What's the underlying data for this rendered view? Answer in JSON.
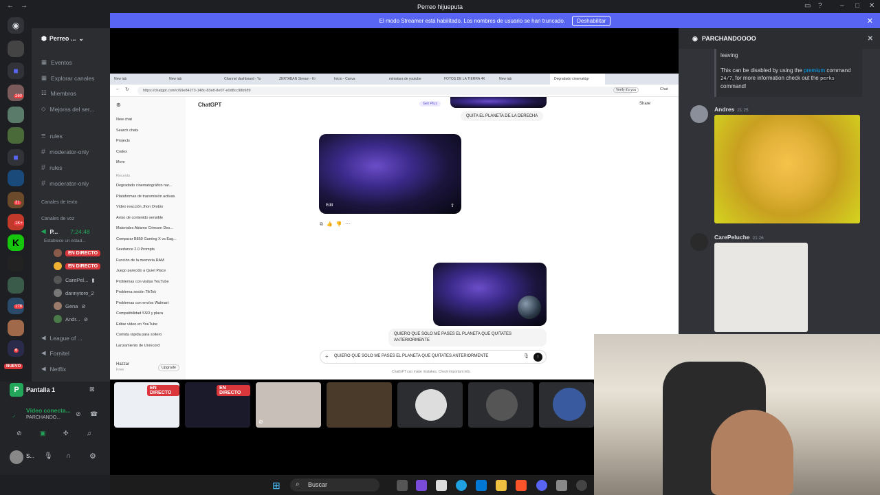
{
  "window": {
    "title": "Perreo hijueputa"
  },
  "banner": {
    "text": "El modo Streamer está habilitado. Los nombres de usuario se han truncado.",
    "button": "Deshabilitar"
  },
  "rail": {
    "badges": [
      "260",
      "31",
      "1K+",
      "178",
      "6"
    ],
    "new_label": "NUEVO"
  },
  "server": {
    "name": "Perreo ..."
  },
  "channels": {
    "items": [
      "Eventos",
      "Explorar canales",
      "Miembros",
      "Mejoras del ser..."
    ],
    "text": [
      "rules",
      "moderator-only",
      "rules",
      "moderator-only"
    ],
    "cat_text": "Canales de texto",
    "cat_voice": "Canales de voz",
    "voice_channel": "P...",
    "voice_time": "7:24:48",
    "voice_status": "Establece un estad...",
    "live": "EN DIRECTO",
    "users": [
      "CarePel...",
      "dannytoro_2",
      "Gena",
      "Andr..."
    ],
    "other_voice": [
      "League of ...",
      "Fornitel",
      "Netflix"
    ]
  },
  "stream_card": {
    "label": "Pantalla 1",
    "status": "Vídeo conecta...",
    "sub": "PARCHANDO...",
    "user": "S..."
  },
  "browser": {
    "tabs": [
      "New tab",
      "New tab",
      "Channel dashboard - Yo",
      "ZERTABAN Stream - Ki",
      "Inicio - Canva",
      "miniatura de youtube",
      "FOTOS DE LA TIERRA 4K",
      "New tab",
      "Degradado cinematógr"
    ],
    "url": "https://chatgpt.com/c/69e84273-148c-83e8-8e07-e0d8cc98b989",
    "verify": "Verify it's you",
    "chat_btn": "Chat"
  },
  "gpt": {
    "brand": "ChatGPT",
    "get_plus": "Get Plus",
    "share": "Share",
    "nav": [
      "New chat",
      "Search chats",
      "Projects",
      "Codex",
      "More"
    ],
    "recents_label": "Recents",
    "recents": [
      "Degradado cinematográfico nar...",
      "Plataformas de transmisión activas",
      "Vídeo reacción Jhon Orobio",
      "Aviso de contenido sensible",
      "Materiales Abismo Crimson Des...",
      "Comparar B850 Gaming X vs Eag...",
      "Seedance 2.0 Prompts",
      "Función de la memoria RAM",
      "Juego parecido a Quiet Place",
      "Problemas con visitas YouTube",
      "Problema sesión TikTok",
      "Problemas con envíos Walmart",
      "Compatibilidad SSD y placa",
      "Editar vídeo en YouTube",
      "Comida rápida para soltero",
      "Lanzamiento de Unrecord"
    ],
    "user": "Hazzar",
    "plan": "Free",
    "upgrade": "Upgrade",
    "msg1": "QUITA EL PLANETA DE LA DERECHA",
    "edit": "Edit",
    "msg2": "QUIERO QUE SOLO ME PASES EL PLANETA QUE QUITATES ANTERIORMENTE",
    "input": "QUIERO QUE SOLO ME PASES EL PLANETA QUE QUITATES ANTERIORMENTE",
    "disclaimer": "ChatGPT can make mistakes. Check important info."
  },
  "right_panel": {
    "title": "PARCHANDOOOO",
    "bot_text1": "leaving",
    "bot_text2": "This can be disabled by using the",
    "bot_cmd": "premium",
    "bot_text3": "command",
    "bot_text4": "24/7",
    "bot_text5": ", for more information check out the",
    "bot_perks": "perks",
    "bot_text6": "command!",
    "msg1_user": "Andres",
    "msg1_time": "21:25",
    "msg2_user": "CarePeluche",
    "msg2_time": "21:26"
  },
  "thumbs": {
    "live1": "EN DIRECTO",
    "live2": "EN DIRECTO"
  },
  "taskbar": {
    "search": "Buscar"
  }
}
